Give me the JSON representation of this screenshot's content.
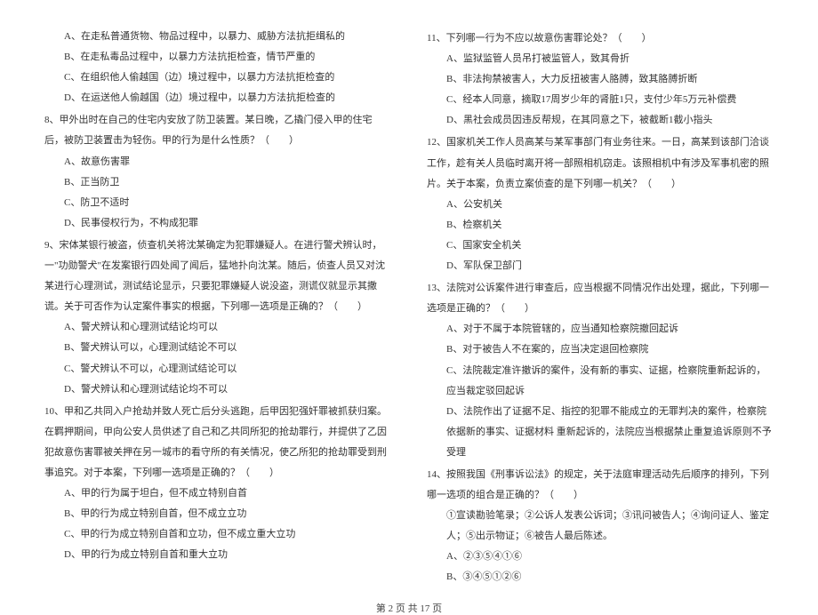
{
  "left": {
    "q7": {
      "A": "A、在走私普通货物、物品过程中，以暴力、威胁方法抗拒缉私的",
      "B": "B、在走私毒品过程中，以暴力方法抗拒检查，情节严重的",
      "C": "C、在组织他人偷越国（边）境过程中，以暴力方法抗拒检查的",
      "D": "D、在运送他人偷越国（边）境过程中，以暴力方法抗拒检查的"
    },
    "q8": {
      "stem": "8、甲外出时在自己的住宅内安放了防卫装置。某日晚，乙撬门侵入甲的住宅后，被防卫装置击为轻伤。甲的行为是什么性质？（　　）",
      "A": "A、故意伤害罪",
      "B": "B、正当防卫",
      "C": "C、防卫不适时",
      "D": "D、民事侵权行为，不构成犯罪"
    },
    "q9": {
      "stem": "9、宋体某银行被盗，侦查机关将沈某确定为犯罪嫌疑人。在进行警犬辨认时，一\"功勋警犬\"在发案银行四处闻了闻后，猛地扑向沈某。随后，侦查人员又对沈某进行心理测试，测试结论显示，只要犯罪嫌疑人说没盗，测谎仪就显示其撒谎。关于可否作为认定案件事实的根据，下列哪一选项是正确的？（　　）",
      "A": "A、警犬辨认和心理测试结论均可以",
      "B": "B、警犬辨认可以，心理测试结论不可以",
      "C": "C、警犬辨认不可以，心理测试结论可以",
      "D": "D、警犬辨认和心理测试结论均不可以"
    },
    "q10": {
      "stem": "10、甲和乙共同入户抢劫并致人死亡后分头逃跑，后甲因犯强奸罪被抓获归案。在羁押期间，甲向公安人员供述了自己和乙共同所犯的抢劫罪行，并提供了乙因犯故意伤害罪被关押在另一城市的看守所的有关情况，使乙所犯的抢劫罪受到刑事追究。对于本案，下列哪一选项是正确的？（　　）",
      "A": "A、甲的行为属于坦白，但不成立特别自首",
      "B": "B、甲的行为成立特别自首，但不成立立功",
      "C": "C、甲的行为成立特别自首和立功，但不成立重大立功",
      "D": "D、甲的行为成立特别自首和重大立功"
    }
  },
  "right": {
    "q11": {
      "stem": "11、下列哪一行为不应以故意伤害罪论处？（　　）",
      "A": "A、监狱监管人员吊打被监管人，致其骨折",
      "B": "B、非法拘禁被害人，大力反扭被害人胳膊，致其胳膊折断",
      "C": "C、经本人同意，摘取17周岁少年的肾脏1只，支付少年5万元补偿费",
      "D": "D、黑社会成员因违反帮规，在其同意之下，被截断1截小指头"
    },
    "q12": {
      "stem": "12、国家机关工作人员高某与某军事部门有业务往来。一日，高某到该部门洽谈工作，趁有关人员临时离开将一部照相机窃走。该照相机中有涉及军事机密的照片。关于本案，负责立案侦查的是下列哪一机关？（　　）",
      "A": "A、公安机关",
      "B": "B、检察机关",
      "C": "C、国家安全机关",
      "D": "D、军队保卫部门"
    },
    "q13": {
      "stem": "13、法院对公诉案件进行审查后，应当根据不同情况作出处理，据此，下列哪一选项是正确的？（　　）",
      "A": "A、对于不属于本院管辖的，应当通知检察院撤回起诉",
      "B": "B、对于被告人不在案的，应当决定退回检察院",
      "C": "C、法院裁定准许撤诉的案件，没有新的事实、证据，检察院重新起诉的，应当裁定驳回起诉",
      "D": "D、法院作出了证据不足、指控的犯罪不能成立的无罪判决的案件，检察院依据新的事实、证据材料 重新起诉的，法院应当根据禁止重复追诉原则不予受理"
    },
    "q14": {
      "stem": "14、按照我国《刑事诉讼法》的规定，关于法庭审理活动先后顺序的排列，下列哪一选项的组合是正确的？（　　）",
      "list": "①宣读勘验笔录；②公诉人发表公诉词；③讯问被告人；④询问证人、鉴定人；⑤出示物证；⑥被告人最后陈述。",
      "A": "A、②③⑤④①⑥",
      "B": "B、③④⑤①②⑥"
    }
  },
  "footer": "第 2 页 共 17 页"
}
